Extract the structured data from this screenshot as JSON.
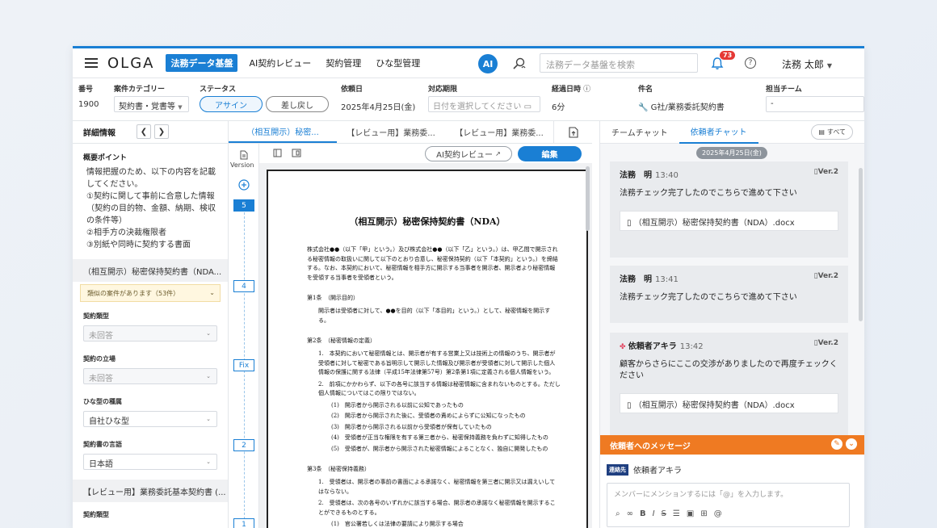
{
  "header": {
    "logo": "OLGA",
    "nav": [
      "法務データ基盤",
      "AI契約レビュー",
      "契約管理",
      "ひな型管理"
    ],
    "ai_badge": "AI",
    "search_placeholder": "法務データ基盤を検索",
    "notification_count": "73",
    "help": "?",
    "user_name": "法務 太郎"
  },
  "meta": {
    "labels": {
      "number": "番号",
      "category": "案件カテゴリー",
      "status": "ステータス",
      "request_date": "依頼日",
      "deadline": "対応期限",
      "elapsed": "経過日時",
      "subject": "件名",
      "team": "担当チーム"
    },
    "number": "1900",
    "category": "契約書・覚書等",
    "status_primary": "アサイン",
    "status_secondary": "差し戻し",
    "request_date": "2025年4月25日(金)",
    "deadline_placeholder": "日付を選択してください",
    "elapsed": "6分",
    "subject": "G社/業務委託契約書",
    "team": "-"
  },
  "left": {
    "title": "詳細情報",
    "overview_title": "概要ポイント",
    "overview_lines": [
      "情報把握のため、以下の内容を記載してください。",
      "①契約に関して事前に合意した情報（契約の目的物、金額、納期、検収の条件等）",
      "②相手方の決裁権限者",
      "③別紙や同時に契約する書面"
    ],
    "doc1": "（相互開示）秘密保持契約書（NDA...",
    "similar": "類似の案件があります（53件）",
    "fields": [
      {
        "label": "契約類型",
        "value": "未回答",
        "disabled": true
      },
      {
        "label": "契約の立場",
        "value": "未回答",
        "disabled": true
      },
      {
        "label": "ひな型の種属",
        "value": "自社ひな型",
        "disabled": false
      },
      {
        "label": "契約書の言語",
        "value": "日本語",
        "disabled": false
      }
    ],
    "doc2": "【レビュー用】業務委託基本契約書 (...",
    "doc2_field_label": "契約類型"
  },
  "center": {
    "tabs": [
      "（相互開示）秘密...",
      "【レビュー用】業務委...",
      "【レビュー用】業務委..."
    ],
    "version_label": "Version",
    "versions": [
      "5",
      "4",
      "Fix",
      "2",
      "1"
    ],
    "ai_review": "AI契約レビュー",
    "edit": "編集",
    "doc": {
      "title": "（相互開示）秘密保持契約書（NDA）",
      "intro": "株式会社●●（以下「甲」という。）及び株式会社●●（以下「乙」という。）は、甲乙間で開示される秘密情報の取扱いに関して以下のとおり合意し、秘密保持契約（以下「本契約」という。）を締結する。なお、本契約において、秘密情報を相手方に開示する当事者を開示者、開示者より秘密情報を受領する当事者を受領者という。",
      "a1_h": "第1条　（開示目的）",
      "a1": "開示者は受領者に対して、●●を目的（以下「本目的」という。）として、秘密情報を開示する。",
      "a2_h": "第2条　（秘密情報の定義）",
      "a2_1": "1.　本契約において秘密情報とは、開示者が有する営業上又は技術上の情報のうち、開示者が受領者に対して秘密である旨明示して開示した情報及び開示者が受領者に対して開示した個人情報の保護に関する法律（平成15年法律第57号）第2条第1項に定義される個人情報をいう。",
      "a2_2": "2.　前項にかかわらず、以下の各号に該当する情報は秘密情報に含まれないものとする。ただし個人情報についてはこの限りではない。",
      "a2_items": [
        "(1)　開示者から開示される以前に公知であったもの",
        "(2)　開示者から開示された後に、受領者の責めによらずに公知になったもの",
        "(3)　開示者から開示される以前から受領者が保有していたもの",
        "(4)　受領者が正当な権限を有する第三者から、秘密保持義務を負わずに知得したもの",
        "(5)　受領者が、開示者から開示された秘密情報によることなく、独自に開発したもの"
      ],
      "a3_h": "第3条　（秘密保持義務）",
      "a3_1": "1.　受領者は、開示者の事前の書面による承諾なく、秘密情報を第三者に開示又は漏えいしてはならない。",
      "a3_2": "2.　受領者は、次の各号のいずれかに該当する場合、開示者の承諾なく秘密情報を開示することができるものとする。",
      "a3_items": [
        "(1)　官公署若しくは法律の要請により開示する場合"
      ]
    }
  },
  "right": {
    "tabs": [
      "チームチャット",
      "依頼者チャット"
    ],
    "all": "すべて",
    "date": "2025年4月25日(金)",
    "messages": [
      {
        "name": "法務　明",
        "time": "13:40",
        "ver": "Ver.2",
        "text": "法務チェック完了したのでこちらで進めて下さい",
        "file": "（相互開示）秘密保持契約書（NDA）.docx"
      },
      {
        "name": "法務　明",
        "time": "13:41",
        "ver": "Ver.2",
        "text": "法務チェック完了したのでこちらで進めて下さい"
      },
      {
        "name": "依頼者アキラ",
        "time": "13:42",
        "ver": "Ver.2",
        "text": "顧客からさらにここの交渉がありましたので再度チェックください",
        "file": "（相互開示）秘密保持契約書（NDA）.docx"
      }
    ],
    "compose_title": "依頼者へのメッセージ",
    "recipient_badge": "連絡先",
    "recipient": "依頼者アキラ",
    "compose_placeholder": "メンバーにメンションするには「@」を入力します。"
  },
  "colors": {
    "accent": "#1a7fd4",
    "compose": "#ef7a22",
    "badge": "#e53935"
  }
}
